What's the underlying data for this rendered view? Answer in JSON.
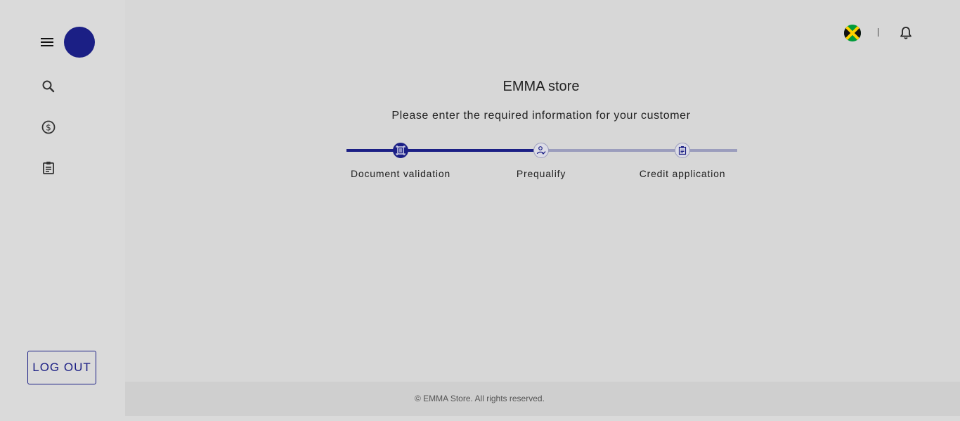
{
  "sidebar": {
    "menu_icon": "hamburger-menu-icon",
    "avatar_color": "#1b1f85",
    "items": [
      {
        "icon": "search-icon"
      },
      {
        "icon": "dollar-circle-icon"
      },
      {
        "icon": "clipboard-icon"
      }
    ],
    "logout_label": "LOG OUT"
  },
  "header": {
    "flag_icon": "jamaica-flag-icon",
    "separator": "|",
    "notification_icon": "bell-icon"
  },
  "main": {
    "title": "EMMA store",
    "subtitle": "Please enter the required information for your customer",
    "stepper": {
      "active_color": "#1b1f85",
      "inactive_color": "#9b9dbd",
      "current_step": 1,
      "steps": [
        {
          "label": "Document validation",
          "icon": "document-scan-icon",
          "active": true
        },
        {
          "label": "Prequalify",
          "icon": "user-check-icon",
          "active": false
        },
        {
          "label": "Credit application",
          "icon": "clipboard-icon",
          "active": false
        }
      ]
    }
  },
  "footer": {
    "text": "© EMMA Store. All rights reserved."
  }
}
